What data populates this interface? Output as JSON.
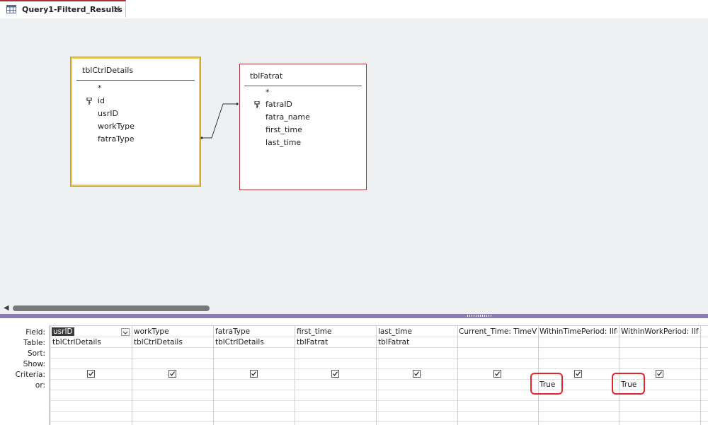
{
  "tab": {
    "label": "Query1-Filterd_Results",
    "close": "×"
  },
  "tables": [
    {
      "title": "tblCtrlDetails",
      "fields": [
        "*",
        "id",
        "usrID",
        "workType",
        "fatraType"
      ]
    },
    {
      "title": "tblFatrat",
      "fields": [
        "*",
        "fatraID",
        "fatra_name",
        "first_time",
        "last_time"
      ]
    }
  ],
  "grid": {
    "row_labels": [
      "Field:",
      "Table:",
      "Sort:",
      "Show:",
      "Criteria:",
      "or:"
    ],
    "columns": [
      {
        "field": "usrID",
        "table": "tblCtrlDetails",
        "show": true,
        "criteria": ""
      },
      {
        "field": "workType",
        "table": "tblCtrlDetails",
        "show": true,
        "criteria": ""
      },
      {
        "field": "fatraType",
        "table": "tblCtrlDetails",
        "show": true,
        "criteria": ""
      },
      {
        "field": "first_time",
        "table": "tblFatrat",
        "show": true,
        "criteria": ""
      },
      {
        "field": "last_time",
        "table": "tblFatrat",
        "show": true,
        "criteria": ""
      },
      {
        "field": "Current_Time: TimeValu",
        "table": "",
        "show": true,
        "criteria": ""
      },
      {
        "field": "WithinTimePeriod: IIf([",
        "table": "",
        "show": true,
        "criteria": "True"
      },
      {
        "field": "WithinWorkPeriod: IIf([",
        "table": "",
        "show": true,
        "criteria": "True"
      }
    ]
  },
  "colors": {
    "accent": "#a4373a",
    "highlight": "#e0262a",
    "selected_table_border": "#f4c542"
  }
}
